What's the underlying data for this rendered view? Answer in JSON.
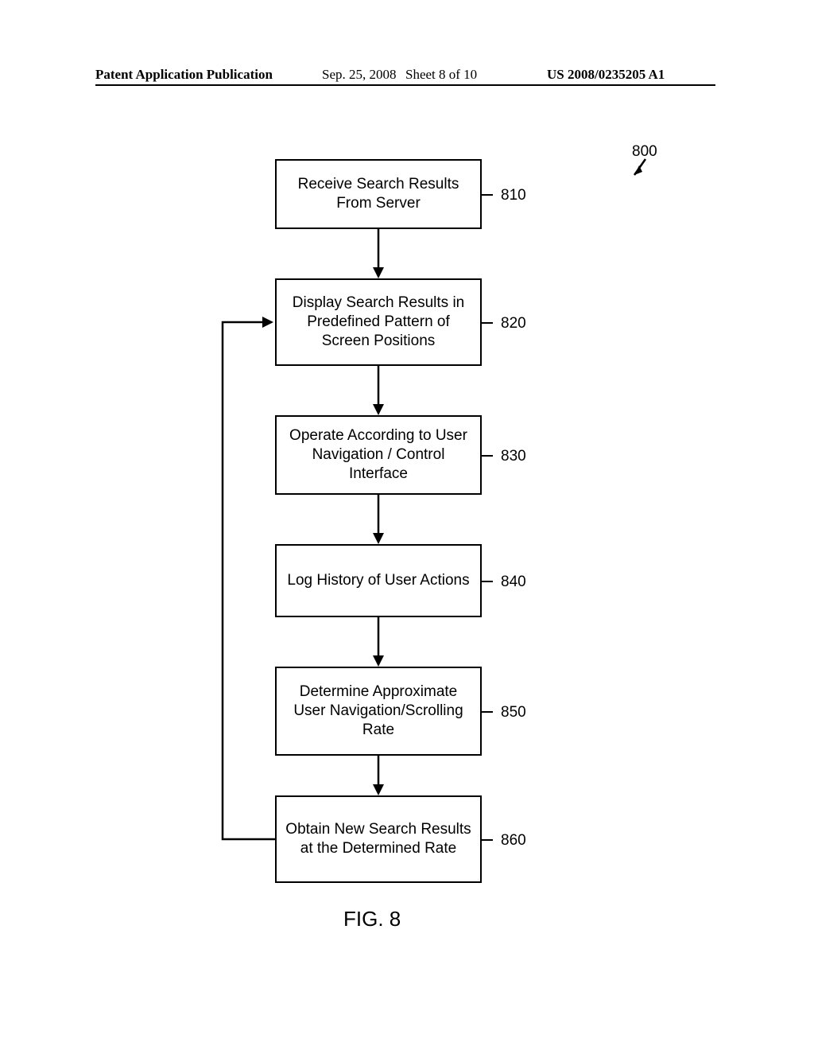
{
  "header": {
    "left": "Patent Application Publication",
    "date": "Sep. 25, 2008",
    "sheet": "Sheet 8 of 10",
    "pub": "US 2008/0235205 A1"
  },
  "refs": {
    "r800": "800",
    "r810": "810",
    "r820": "820",
    "r830": "830",
    "r840": "840",
    "r850": "850",
    "r860": "860"
  },
  "boxes": {
    "b810": "Receive Search Results From Server",
    "b820": "Display Search Results in Predefined Pattern of Screen Positions",
    "b830": "Operate According to User Navigation / Control Interface",
    "b840": "Log History of User Actions",
    "b850": "Determine Approximate User Navigation/Scrolling Rate",
    "b860": "Obtain New Search Results at the Determined Rate"
  },
  "figure_caption": "FIG. 8"
}
